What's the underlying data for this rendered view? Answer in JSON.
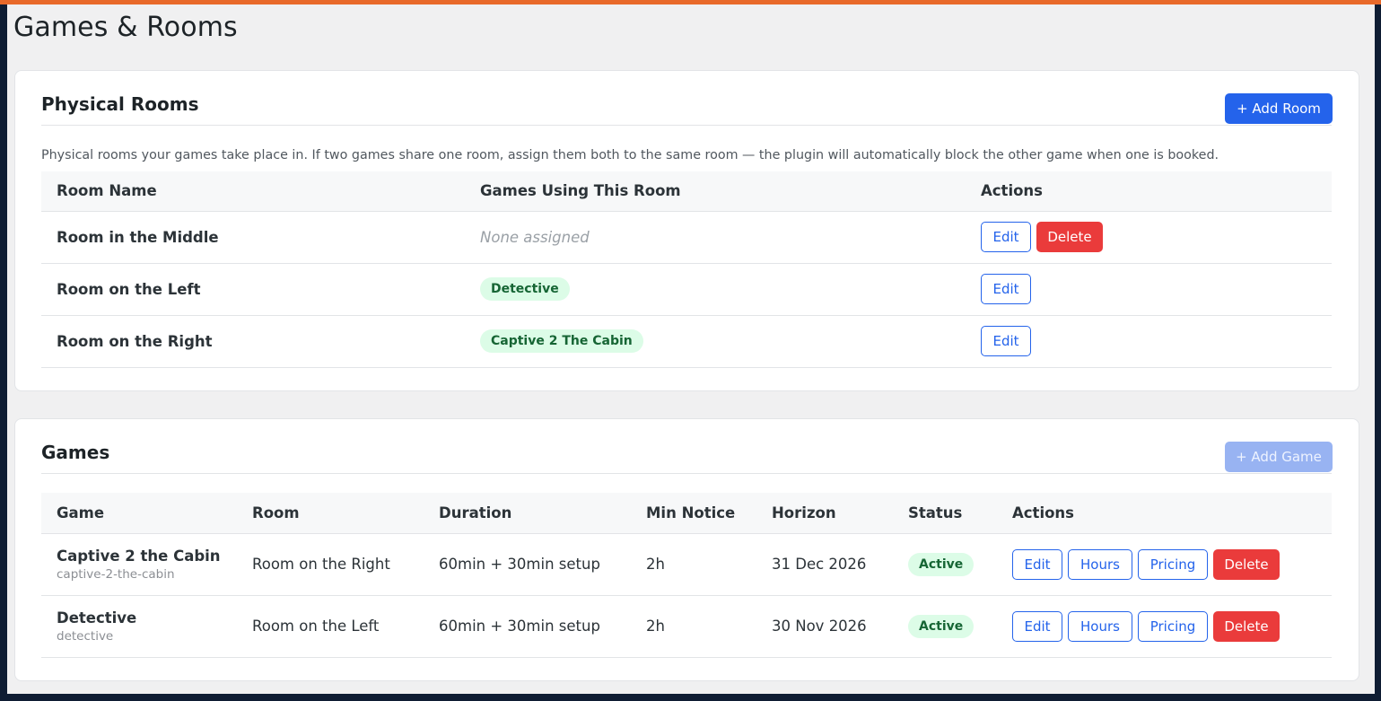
{
  "page": {
    "title": "Games & Rooms"
  },
  "rooms_card": {
    "title": "Physical Rooms",
    "add_button": "+ Add Room",
    "description": "Physical rooms your games take place in. If two games share one room, assign them both to the same room — the plugin will automatically block the other game when one is booked.",
    "columns": [
      "Room Name",
      "Games Using This Room",
      "Actions"
    ],
    "rows": [
      {
        "name": "Room in the Middle",
        "games": "None assigned",
        "edit": "Edit",
        "delete": "Delete"
      },
      {
        "name": "Room on the Left",
        "games": "Detective",
        "edit": "Edit"
      },
      {
        "name": "Room on the Right",
        "games": "Captive 2 The Cabin",
        "edit": "Edit"
      }
    ]
  },
  "games_card": {
    "title": "Games",
    "add_button": "+ Add Game",
    "columns": [
      "Game",
      "Room",
      "Duration",
      "Min Notice",
      "Horizon",
      "Status",
      "Actions"
    ],
    "rows": [
      {
        "name": "Captive 2 the Cabin",
        "slug": "captive-2-the-cabin",
        "room": "Room on the Right",
        "duration": "60min + 30min setup",
        "min_notice": "2h",
        "horizon": "31 Dec 2026",
        "status": "Active",
        "actions": {
          "edit": "Edit",
          "hours": "Hours",
          "pricing": "Pricing",
          "delete": "Delete"
        }
      },
      {
        "name": "Detective",
        "slug": "detective",
        "room": "Room on the Left",
        "duration": "60min + 30min setup",
        "min_notice": "2h",
        "horizon": "30 Nov 2026",
        "status": "Active",
        "actions": {
          "edit": "Edit",
          "hours": "Hours",
          "pricing": "Pricing",
          "delete": "Delete"
        }
      }
    ]
  },
  "colors": {
    "accent": "#2463eb",
    "danger": "#ea3b3b",
    "success_bg": "#dcfce7",
    "success_text": "#166534",
    "top_bar": "#e8692a"
  }
}
